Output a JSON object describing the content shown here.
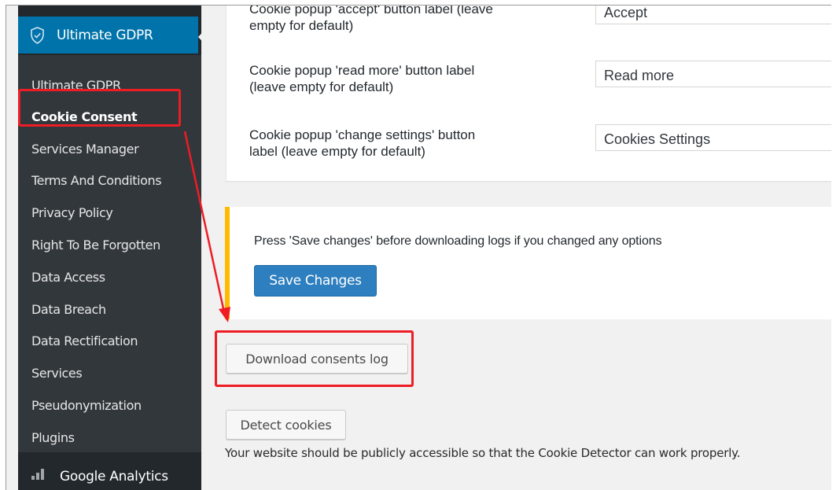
{
  "sidebar": {
    "active_section": "Ultimate GDPR",
    "items": [
      {
        "label": "Ultimate GDPR"
      },
      {
        "label": "Cookie Consent",
        "current": true
      },
      {
        "label": "Services Manager"
      },
      {
        "label": "Terms And Conditions"
      },
      {
        "label": "Privacy Policy"
      },
      {
        "label": "Right To Be Forgotten"
      },
      {
        "label": "Data Access"
      },
      {
        "label": "Data Breach"
      },
      {
        "label": "Data Rectification"
      },
      {
        "label": "Services"
      },
      {
        "label": "Pseudonymization"
      },
      {
        "label": "Plugins"
      }
    ],
    "bottom_item": "Google Analytics",
    "icons": {
      "active_section": "shield-check-icon",
      "bottom_item": "google-analytics-icon"
    }
  },
  "settings": {
    "rows": [
      {
        "label": "Cookie popup 'accept' button label (leave\nempty for default)",
        "value": "Accept"
      },
      {
        "label": "Cookie popup 'read more' button label\n(leave empty for default)",
        "value": "Read more"
      },
      {
        "label": "Cookie popup 'change settings' button\nlabel (leave empty for default)",
        "value": "Cookies Settings"
      }
    ]
  },
  "notice": {
    "text": "Press 'Save changes' before downloading logs if you changed any options",
    "save_label": "Save Changes"
  },
  "actions": {
    "download_label": "Download consents log",
    "detect_label": "Detect cookies",
    "helper_text": "Your website should be publicly accessible so that the Cookie Detector can work properly."
  },
  "colors": {
    "sidebar_bg": "#23282d",
    "submenu_bg": "#32373c",
    "accent": "#0073aa",
    "notice_border": "#ffb900",
    "primary_button": "#2e7fbf",
    "highlight": "#ee1c25"
  }
}
